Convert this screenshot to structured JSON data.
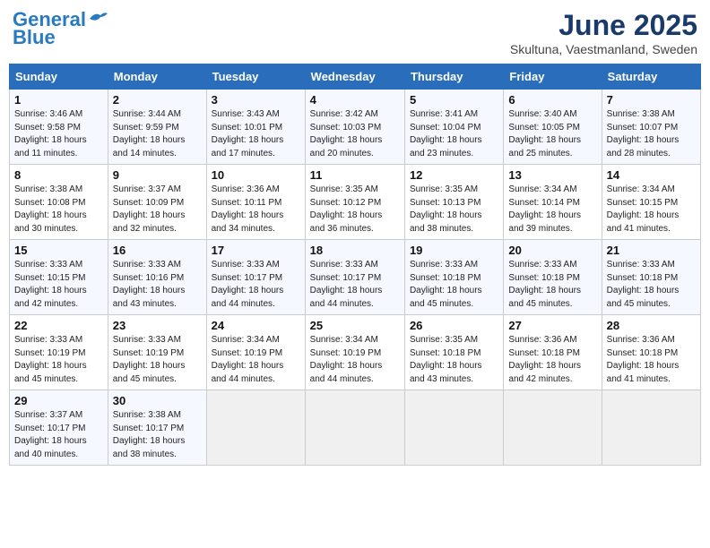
{
  "header": {
    "logo_line1": "General",
    "logo_line2": "Blue",
    "month_title": "June 2025",
    "subtitle": "Skultuna, Vaestmanland, Sweden"
  },
  "weekdays": [
    "Sunday",
    "Monday",
    "Tuesday",
    "Wednesday",
    "Thursday",
    "Friday",
    "Saturday"
  ],
  "weeks": [
    [
      {
        "day": "1",
        "info": "Sunrise: 3:46 AM\nSunset: 9:58 PM\nDaylight: 18 hours\nand 11 minutes."
      },
      {
        "day": "2",
        "info": "Sunrise: 3:44 AM\nSunset: 9:59 PM\nDaylight: 18 hours\nand 14 minutes."
      },
      {
        "day": "3",
        "info": "Sunrise: 3:43 AM\nSunset: 10:01 PM\nDaylight: 18 hours\nand 17 minutes."
      },
      {
        "day": "4",
        "info": "Sunrise: 3:42 AM\nSunset: 10:03 PM\nDaylight: 18 hours\nand 20 minutes."
      },
      {
        "day": "5",
        "info": "Sunrise: 3:41 AM\nSunset: 10:04 PM\nDaylight: 18 hours\nand 23 minutes."
      },
      {
        "day": "6",
        "info": "Sunrise: 3:40 AM\nSunset: 10:05 PM\nDaylight: 18 hours\nand 25 minutes."
      },
      {
        "day": "7",
        "info": "Sunrise: 3:38 AM\nSunset: 10:07 PM\nDaylight: 18 hours\nand 28 minutes."
      }
    ],
    [
      {
        "day": "8",
        "info": "Sunrise: 3:38 AM\nSunset: 10:08 PM\nDaylight: 18 hours\nand 30 minutes."
      },
      {
        "day": "9",
        "info": "Sunrise: 3:37 AM\nSunset: 10:09 PM\nDaylight: 18 hours\nand 32 minutes."
      },
      {
        "day": "10",
        "info": "Sunrise: 3:36 AM\nSunset: 10:11 PM\nDaylight: 18 hours\nand 34 minutes."
      },
      {
        "day": "11",
        "info": "Sunrise: 3:35 AM\nSunset: 10:12 PM\nDaylight: 18 hours\nand 36 minutes."
      },
      {
        "day": "12",
        "info": "Sunrise: 3:35 AM\nSunset: 10:13 PM\nDaylight: 18 hours\nand 38 minutes."
      },
      {
        "day": "13",
        "info": "Sunrise: 3:34 AM\nSunset: 10:14 PM\nDaylight: 18 hours\nand 39 minutes."
      },
      {
        "day": "14",
        "info": "Sunrise: 3:34 AM\nSunset: 10:15 PM\nDaylight: 18 hours\nand 41 minutes."
      }
    ],
    [
      {
        "day": "15",
        "info": "Sunrise: 3:33 AM\nSunset: 10:15 PM\nDaylight: 18 hours\nand 42 minutes."
      },
      {
        "day": "16",
        "info": "Sunrise: 3:33 AM\nSunset: 10:16 PM\nDaylight: 18 hours\nand 43 minutes."
      },
      {
        "day": "17",
        "info": "Sunrise: 3:33 AM\nSunset: 10:17 PM\nDaylight: 18 hours\nand 44 minutes."
      },
      {
        "day": "18",
        "info": "Sunrise: 3:33 AM\nSunset: 10:17 PM\nDaylight: 18 hours\nand 44 minutes."
      },
      {
        "day": "19",
        "info": "Sunrise: 3:33 AM\nSunset: 10:18 PM\nDaylight: 18 hours\nand 45 minutes."
      },
      {
        "day": "20",
        "info": "Sunrise: 3:33 AM\nSunset: 10:18 PM\nDaylight: 18 hours\nand 45 minutes."
      },
      {
        "day": "21",
        "info": "Sunrise: 3:33 AM\nSunset: 10:18 PM\nDaylight: 18 hours\nand 45 minutes."
      }
    ],
    [
      {
        "day": "22",
        "info": "Sunrise: 3:33 AM\nSunset: 10:19 PM\nDaylight: 18 hours\nand 45 minutes."
      },
      {
        "day": "23",
        "info": "Sunrise: 3:33 AM\nSunset: 10:19 PM\nDaylight: 18 hours\nand 45 minutes."
      },
      {
        "day": "24",
        "info": "Sunrise: 3:34 AM\nSunset: 10:19 PM\nDaylight: 18 hours\nand 44 minutes."
      },
      {
        "day": "25",
        "info": "Sunrise: 3:34 AM\nSunset: 10:19 PM\nDaylight: 18 hours\nand 44 minutes."
      },
      {
        "day": "26",
        "info": "Sunrise: 3:35 AM\nSunset: 10:18 PM\nDaylight: 18 hours\nand 43 minutes."
      },
      {
        "day": "27",
        "info": "Sunrise: 3:36 AM\nSunset: 10:18 PM\nDaylight: 18 hours\nand 42 minutes."
      },
      {
        "day": "28",
        "info": "Sunrise: 3:36 AM\nSunset: 10:18 PM\nDaylight: 18 hours\nand 41 minutes."
      }
    ],
    [
      {
        "day": "29",
        "info": "Sunrise: 3:37 AM\nSunset: 10:17 PM\nDaylight: 18 hours\nand 40 minutes."
      },
      {
        "day": "30",
        "info": "Sunrise: 3:38 AM\nSunset: 10:17 PM\nDaylight: 18 hours\nand 38 minutes."
      },
      {
        "day": "",
        "info": ""
      },
      {
        "day": "",
        "info": ""
      },
      {
        "day": "",
        "info": ""
      },
      {
        "day": "",
        "info": ""
      },
      {
        "day": "",
        "info": ""
      }
    ]
  ]
}
